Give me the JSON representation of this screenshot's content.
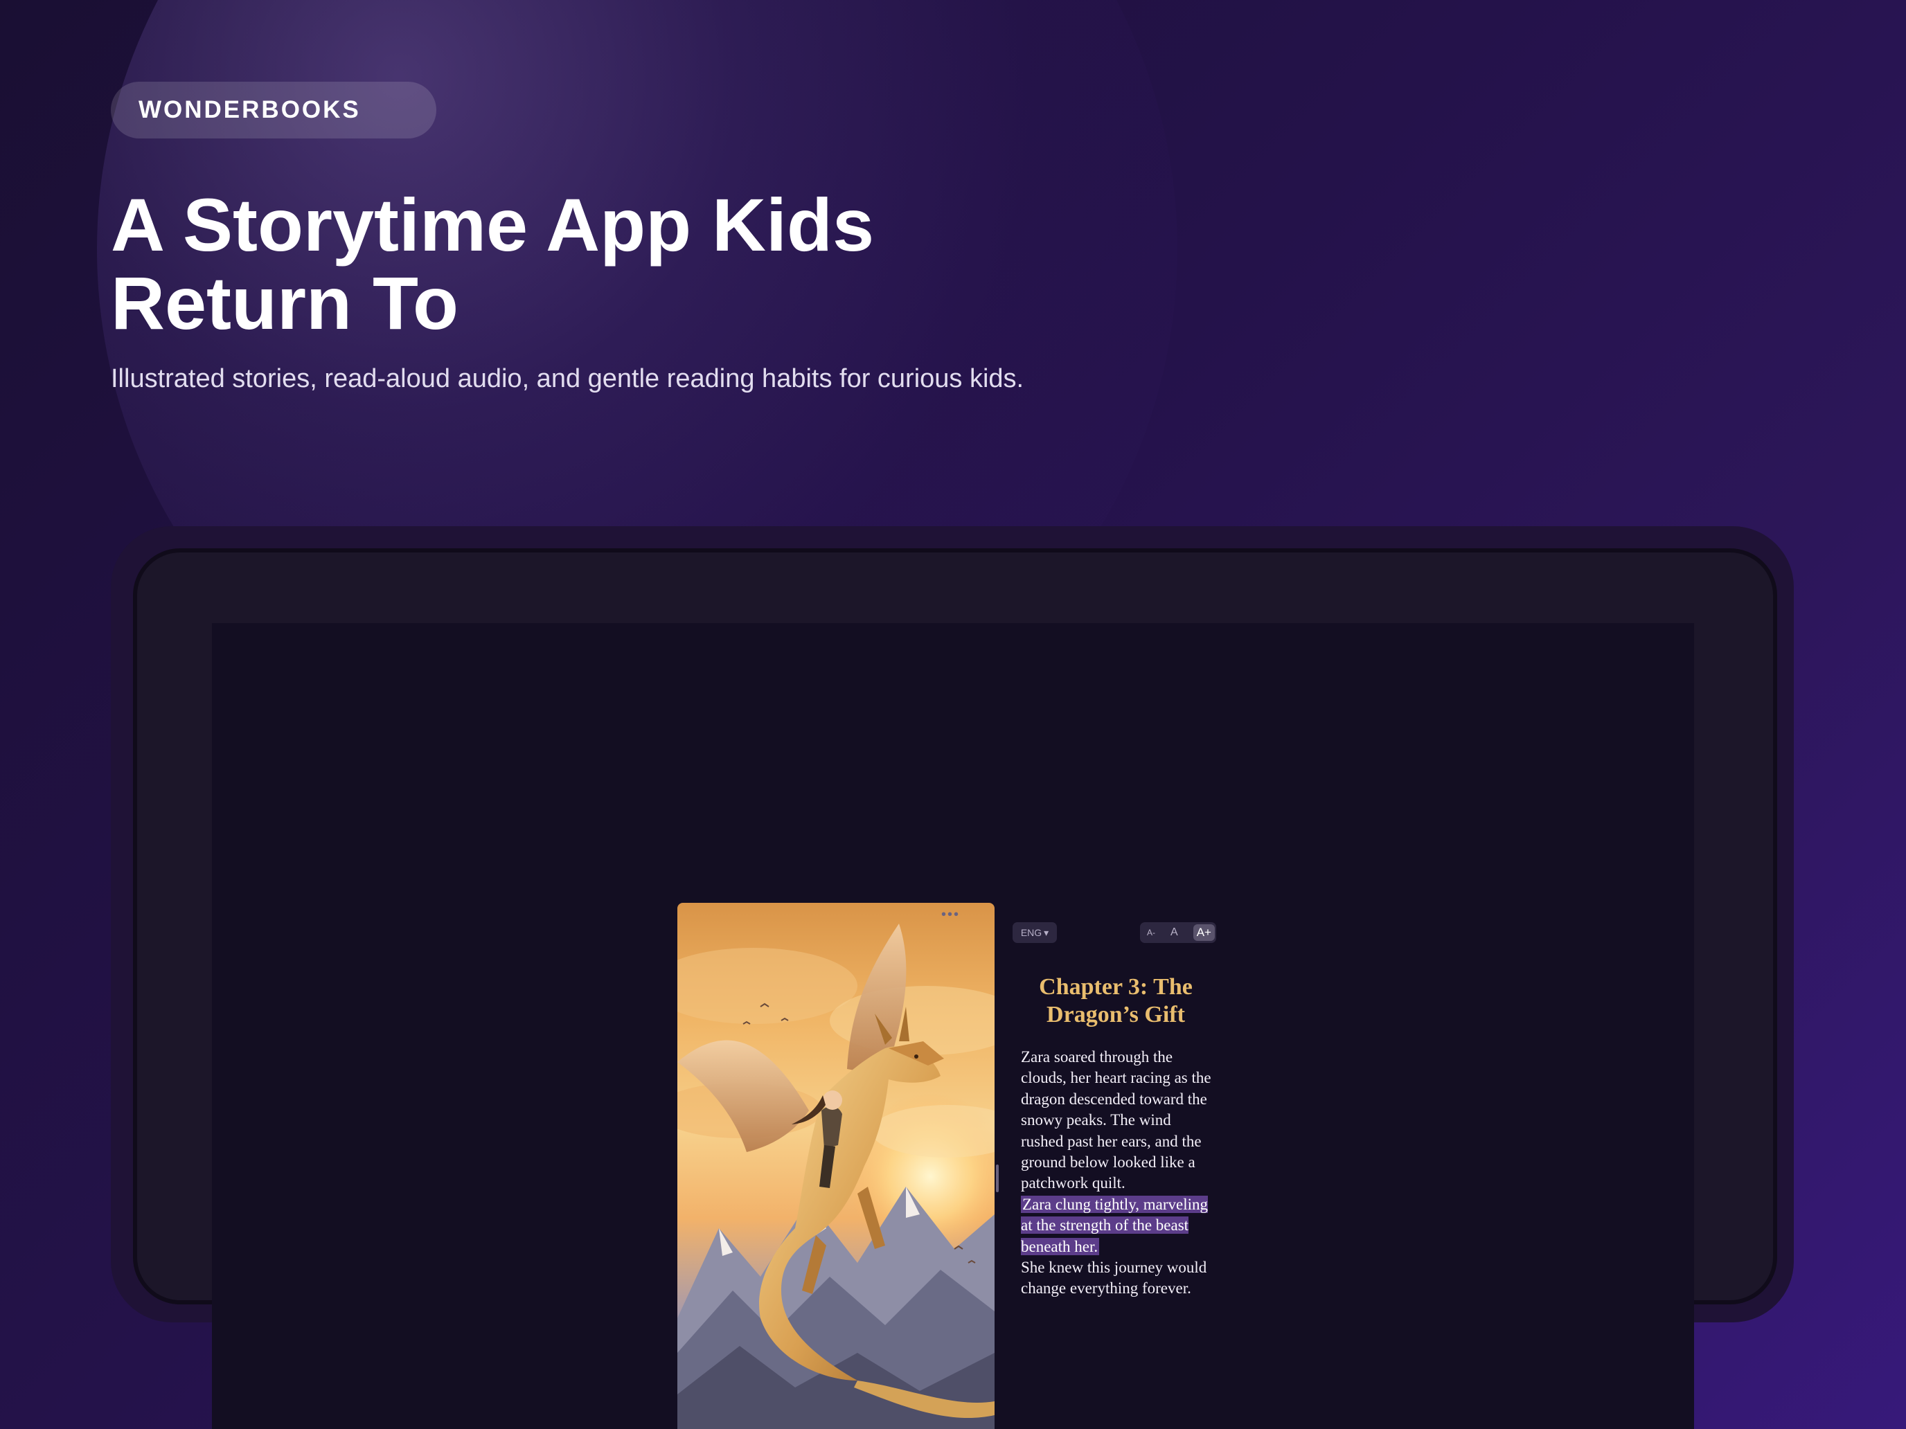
{
  "brand": {
    "name": "WONDERBOOKS"
  },
  "hero": {
    "title": "A Storytime App Kids Return To",
    "subtitle": "Illustrated stories, read-aloud audio, and gentle reading habits for curious kids."
  },
  "reader": {
    "menu_icon": "more-dots-icon",
    "illustration_description": "A girl riding a golden dragon above snowy mountains at sunset",
    "language": {
      "label": "ENG",
      "icon": "chevron-down-icon"
    },
    "text_size": {
      "decrease_label": "A-",
      "default_label": "A",
      "increase_label": "A+"
    },
    "chapter_title": "Chapter 3: The Dragon’s Gift",
    "story": {
      "before": "Zara soared through the clouds, her heart racing as the dragon descended toward the snowy peaks. The wind rushed past her ears, and the ground below looked like a patchwork quilt.",
      "highlighted": "Zara clung tightly, marveling at the strength of the beast beneath her.",
      "after": "She knew this journey would change everything forever."
    }
  },
  "colors": {
    "background": "#24124a",
    "accent_title": "#e9bd6e",
    "highlight": "#5c3d8a"
  }
}
